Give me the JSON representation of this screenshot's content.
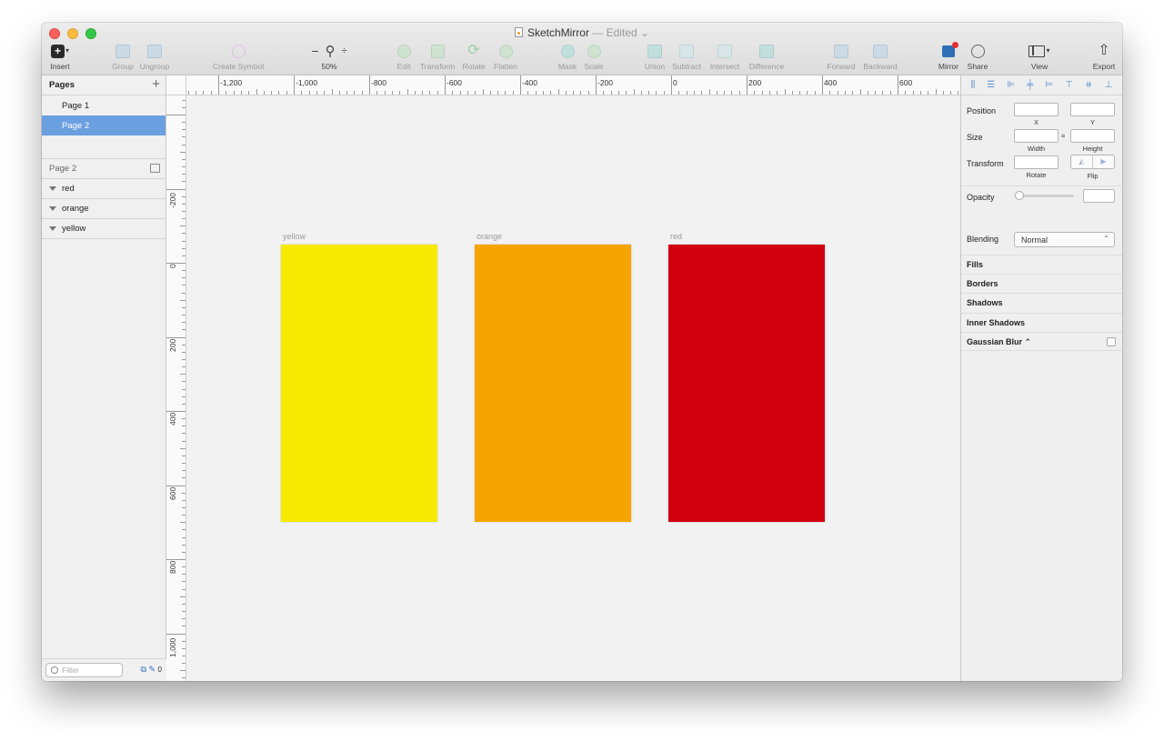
{
  "window": {
    "title": "SketchMirror",
    "edited_suffix": "— Edited ⌄"
  },
  "toolbar": {
    "insert": "Insert",
    "group": "Group",
    "ungroup": "Ungroup",
    "create_symbol": "Create Symbol",
    "zoom_minus": "−",
    "zoom_plus": "÷",
    "zoom_value": "50%",
    "edit": "Edit",
    "transform": "Transform",
    "rotate": "Rotate",
    "flatten": "Flatten",
    "mask": "Mask",
    "scale": "Scale",
    "union": "Union",
    "subtract": "Subtract",
    "intersect": "Intersect",
    "difference": "Difference",
    "forward": "Forward",
    "backward": "Backward",
    "mirror": "Mirror",
    "share": "Share",
    "view": "View",
    "export": "Export"
  },
  "ruler_h": {
    "labels": [
      "-1,200",
      "-1,000",
      "-800",
      "-600",
      "-400",
      "-200",
      "0",
      "200",
      "400",
      "600"
    ]
  },
  "ruler_v": {
    "labels": [
      "-200",
      "0",
      "200",
      "400",
      "600",
      "800",
      "1,000"
    ]
  },
  "pages": {
    "header": "Pages",
    "add_icon": "+",
    "items": [
      {
        "label": "Page 1",
        "selected": false
      },
      {
        "label": "Page 2",
        "selected": true
      }
    ]
  },
  "layers": {
    "header": "Page 2",
    "items": [
      {
        "label": "red"
      },
      {
        "label": "orange"
      },
      {
        "label": "yellow"
      }
    ],
    "filter_placeholder": "Filter",
    "count": "0"
  },
  "artboards": [
    {
      "label": "yellow",
      "color": "#f7ea00"
    },
    {
      "label": "orange",
      "color": "#f6a500"
    },
    {
      "label": "red",
      "color": "#d2000f"
    }
  ],
  "inspector": {
    "position": "Position",
    "x": "X",
    "y": "Y",
    "size": "Size",
    "width": "Width",
    "height": "Height",
    "transform": "Transform",
    "rotate": "Rotate",
    "flip": "Flip",
    "opacity": "Opacity",
    "blending": "Blending",
    "blending_value": "Normal",
    "sections": [
      "Fills",
      "Borders",
      "Shadows",
      "Inner Shadows",
      "Gaussian Blur ⌃"
    ]
  }
}
